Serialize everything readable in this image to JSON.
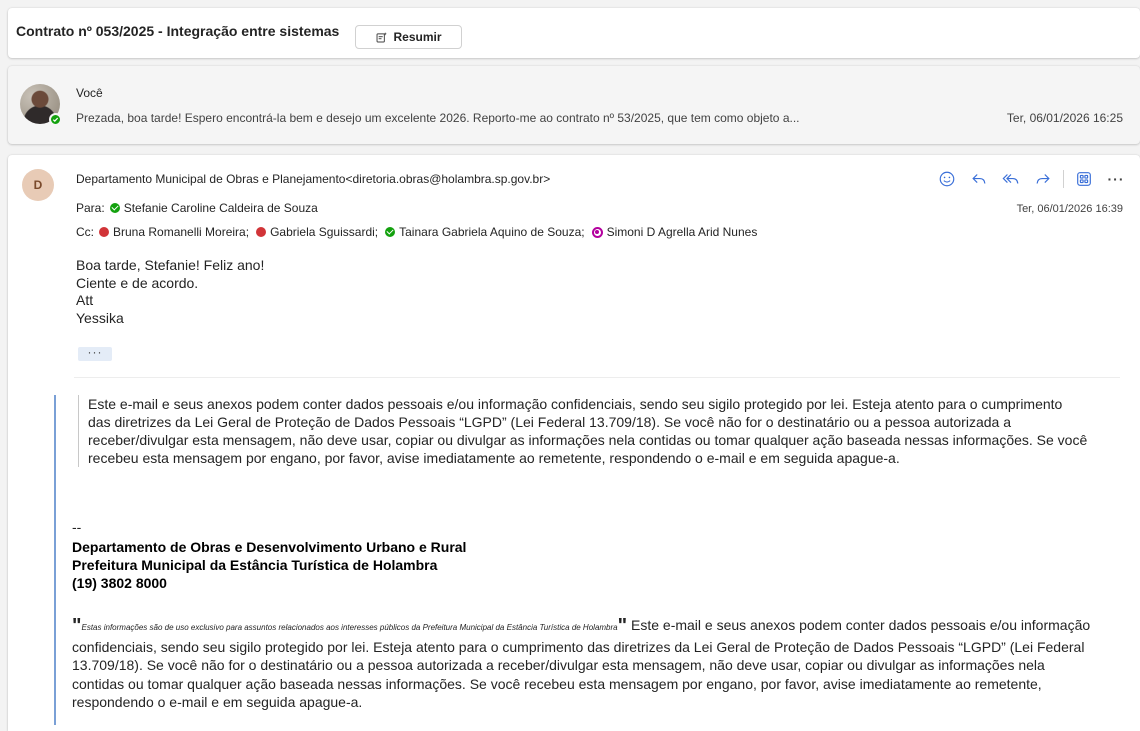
{
  "subject": {
    "title": "Contrato nº 053/2025 - Integração entre sistemas",
    "summarize_label": "Resumir"
  },
  "collapsed_message": {
    "sender": "Você",
    "preview": "Prezada, boa tarde! Espero encontrá-la bem e desejo um excelente 2026. Reporto-me ao contrato nº 53/2025, que tem como objeto a...",
    "time": "Ter, 06/01/2026 16:25"
  },
  "message": {
    "avatar_initial": "D",
    "sender": "Departamento Municipal de Obras e Planejamento<diretoria.obras@holambra.sp.gov.br>",
    "time": "Ter, 06/01/2026 16:39",
    "to_label": "Para:",
    "to": [
      {
        "name": "Stefanie Caroline Caldeira de Souza",
        "status": "available"
      }
    ],
    "cc_label": "Cc:",
    "cc": [
      {
        "name": "Bruna Romanelli Moreira;",
        "status": "busy"
      },
      {
        "name": "Gabriela Sguissardi;",
        "status": "busy"
      },
      {
        "name": "Tainara Gabriela Aquino de Souza;",
        "status": "available"
      },
      {
        "name": "Simoni D Agrella Arid Nunes",
        "status": "out-of-office"
      }
    ],
    "body_lines": [
      "Boa tarde, Stefanie! Feliz ano!",
      "Ciente e de acordo.",
      "Att",
      "Yessika"
    ],
    "expand_label": "···",
    "quoted_notice": "Este e-mail e seus anexos podem conter dados pessoais e/ou informação confidenciais, sendo seu sigilo protegido por lei. Esteja atento para o cumprimento das diretrizes da Lei Geral de Proteção de Dados Pessoais “LGPD” (Lei Federal 13.709/18). Se você não for o destinatário ou a pessoa autorizada a receber/divulgar esta mensagem, não deve usar, copiar ou divulgar as informações nela contidas ou tomar qualquer ação baseada nessas informações. Se você recebeu esta mensagem por engano, por favor, avise imediatamente ao remetente, respondendo o e-mail e em seguida apague-a.",
    "signature_dash": "--",
    "signature": [
      "Departamento de Obras e Desenvolvimento Urbano e Rural",
      "Prefeitura Municipal da Estância Turística de Holambra",
      "(19) 3802 8000"
    ],
    "disclaimer_small": "Estas informações são de uso exclusivo para assuntos relacionados aos interesses públicos da Prefeitura Municipal da Estância Turística de Holambra",
    "disclaimer_main": " Este e-mail e seus anexos podem conter dados pessoais e/ou informação confidenciais, sendo seu sigilo protegido por lei. Esteja atento para o cumprimento das diretrizes da Lei Geral de Proteção de Dados Pessoais “LGPD” (Lei Federal 13.709/18). Se você não for o destinatário ou a pessoa autorizada a receber/divulgar esta mensagem, não deve usar, copiar ou divulgar as informações nela contidas ou tomar qualquer ação baseada nessas informações. Se você recebeu esta mensagem por engano, por favor, avise imediatamente ao remetente, respondendo o e-mail e em seguida apague-a.",
    "quote_mark_open": "\"",
    "quote_mark_close": "\""
  },
  "icons": {
    "summarize": "summarize-icon",
    "emoji": "emoji-icon",
    "reply": "reply-icon",
    "reply_all": "reply-all-icon",
    "forward": "forward-icon",
    "apps": "apps-icon",
    "more": "more-icon"
  },
  "colors": {
    "accent": "#3a6fd8",
    "available": "#13a10e",
    "busy": "#d13438",
    "out_of_office": "#b4009e"
  }
}
